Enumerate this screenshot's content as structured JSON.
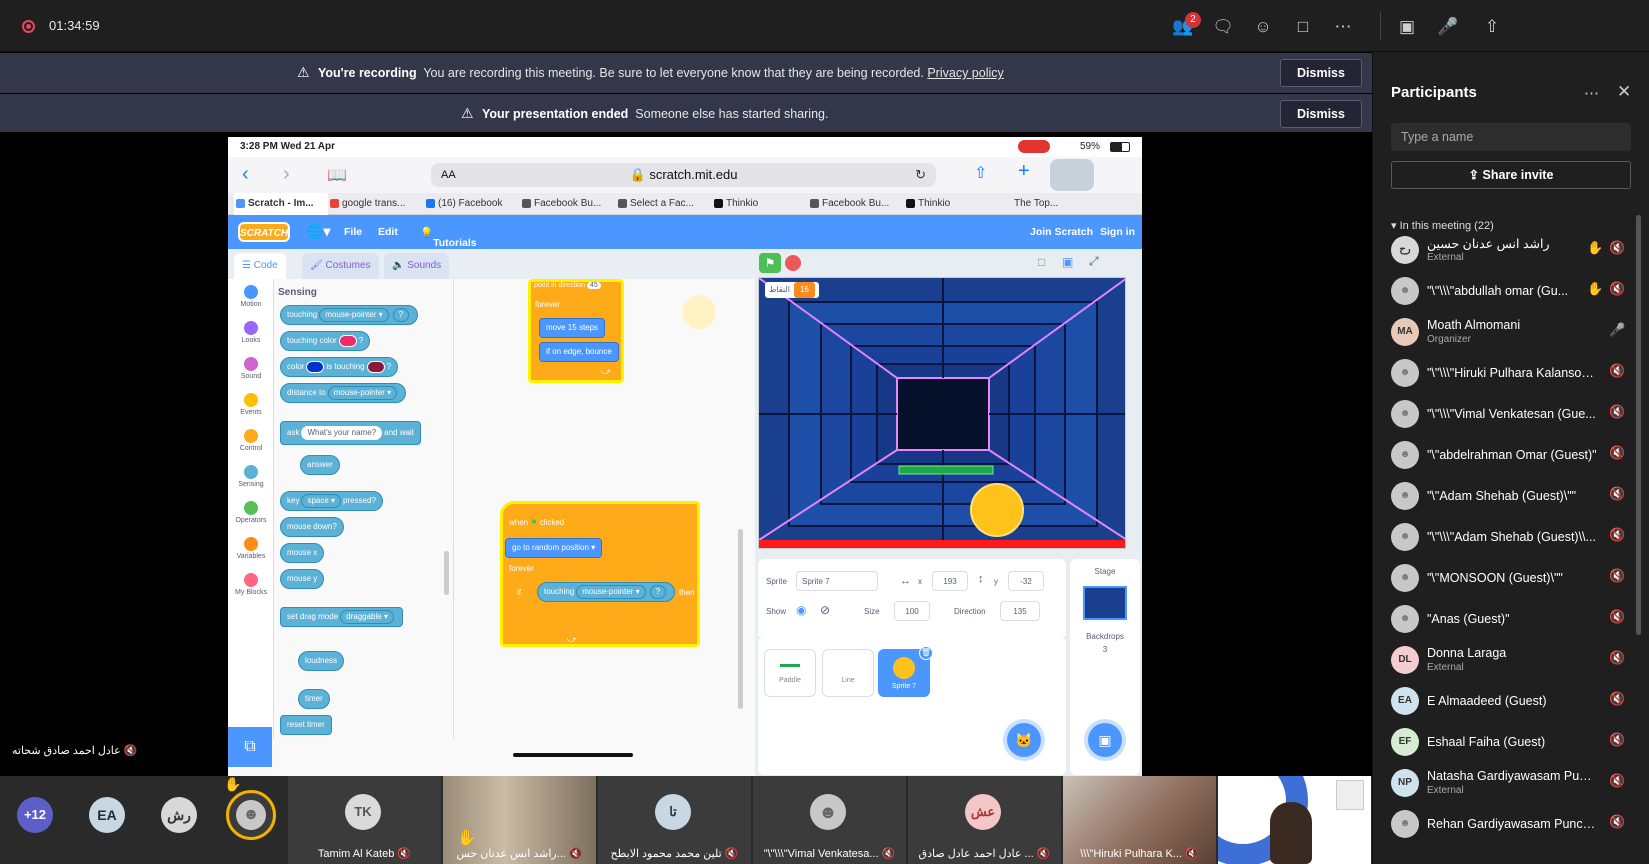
{
  "meeting": {
    "timer": "01:34:59",
    "participants_badge": "2"
  },
  "banners": [
    {
      "title": "You're recording",
      "message": "You are recording this meeting. Be sure to let everyone know that they are being recorded.",
      "link": "Privacy policy",
      "dismiss": "Dismiss"
    },
    {
      "title": "Your presentation ended",
      "message": "Someone else has started sharing.",
      "link": "",
      "dismiss": "Dismiss"
    }
  ],
  "ipad": {
    "time": "3:28 PM  Wed 21 Apr",
    "battery": "59%",
    "url": "scratch.mit.edu",
    "aa": "AA",
    "tabs": [
      "Scratch - Im...",
      "google trans...",
      "(16) Facebook",
      "Facebook Bu...",
      "Select a Fac...",
      "Thinkio",
      "Facebook Bu...",
      "Thinkio",
      "The Top..."
    ]
  },
  "scratch": {
    "menu": {
      "logo": "SCRATCH",
      "file": "File",
      "edit": "Edit",
      "tutorials": "Tutorials",
      "join": "Join Scratch",
      "signin": "Sign in"
    },
    "tabs": {
      "code": "Code",
      "costumes": "Costumes",
      "sounds": "Sounds"
    },
    "categories": [
      "Motion",
      "Looks",
      "Sound",
      "Events",
      "Control",
      "Sensing",
      "Operators",
      "Variables",
      "My Blocks"
    ],
    "category_colors": [
      "#4c97ff",
      "#9966ff",
      "#cf63cf",
      "#ffbf00",
      "#ffab19",
      "#5cb1d6",
      "#59c059",
      "#ff8c1a",
      "#ff6680"
    ],
    "palette_title": "Sensing",
    "blocks": {
      "touching": "touching",
      "mouse_pointer": "mouse-pointer ▾",
      "q": "?",
      "touching_color": "touching color",
      "color": "color",
      "is_touching": "is touching",
      "distance_to": "distance to",
      "ask": "ask",
      "whats_your_name": "What's your name?",
      "and_wait": "and wait",
      "answer": "answer",
      "key": "key",
      "space": "space ▾",
      "pressed": "pressed?",
      "mouse_down": "mouse down?",
      "mouse_x": "mouse x",
      "mouse_y": "mouse y",
      "set_drag_mode": "set drag mode",
      "draggable": "draggable ▾",
      "loudness": "loudness",
      "timer": "timer",
      "reset_timer": "reset timer"
    },
    "script1": {
      "point": "point in direction",
      "point_val": "45",
      "forever": "forever",
      "move": "move",
      "steps_val": "15",
      "steps": "steps",
      "bounce": "if on edge, bounce"
    },
    "script2": {
      "when": "when",
      "clicked": "clicked",
      "goto": "go to",
      "random": "random position ▾",
      "forever": "forever",
      "if": "if",
      "touching": "touching",
      "mouse_pointer": "mouse-pointer ▾",
      "q": "?",
      "then": "then"
    },
    "stage": {
      "score_label": "النقاط",
      "score_value": "16"
    },
    "sprite": {
      "label": "Sprite",
      "name": "Sprite 7",
      "x_label": "x",
      "x": "193",
      "y_label": "y",
      "y": "-32",
      "show": "Show",
      "size_label": "Size",
      "size": "100",
      "direction_label": "Direction",
      "direction": "135"
    },
    "sprites": [
      "Paddle",
      "Line",
      "Sprite 7"
    ],
    "stage_side": {
      "title": "Stage",
      "backdrops": "Backdrops",
      "count": "3"
    }
  },
  "presenter_label": "عادل احمد صادق شحاته",
  "bottom": {
    "more": "+12",
    "avatars": [
      "EA",
      "رش"
    ],
    "tiles": [
      {
        "initials": "TK",
        "name": "Tamim Al Kateb"
      },
      {
        "initials": "",
        "name": "راشد انس عدنان حس..."
      },
      {
        "initials": "تا",
        "name": "تلين محمد محمود الابطح"
      },
      {
        "initials": "",
        "name": "\"\\\"\\\\\\\"Vimal Venkatesa..."
      },
      {
        "initials": "عش",
        "name": "عادل احمد عادل صادق ..."
      },
      {
        "initials": "",
        "name": "\\\\\\\"Hiruki Pulhara K..."
      },
      {
        "initials": "",
        "name": ""
      }
    ]
  },
  "panel": {
    "title": "Participants",
    "search_placeholder": "Type a name",
    "share": "Share invite",
    "section": "In this meeting (22)",
    "people": [
      {
        "name": "راشد انس عدنان حسين",
        "sub": "External",
        "initials": "رح",
        "hand": true,
        "color": "#d8d8d8"
      },
      {
        "name": "\"\\\"\\\\\\\"abdullah omar (Gu...",
        "sub": "",
        "initials": "",
        "hand": true,
        "color": "#c8c8c8"
      },
      {
        "name": "Moath Almomani",
        "sub": "Organizer",
        "initials": "MA",
        "hand": false,
        "color": "#e8c8b8"
      },
      {
        "name": "\"\\\"\\\\\\\"Hiruki Pulhara Kalansoo...",
        "sub": "",
        "initials": "",
        "hand": false,
        "color": "#c8c8c8"
      },
      {
        "name": "\"\\\"\\\\\\\"Vimal Venkatesan (Gue...",
        "sub": "",
        "initials": "",
        "hand": false,
        "color": "#c8c8c8"
      },
      {
        "name": "\"\\\"abdelrahman Omar (Guest)\"",
        "sub": "",
        "initials": "",
        "hand": false,
        "color": "#c8c8c8"
      },
      {
        "name": "\"\\\"Adam Shehab (Guest)\\\"\"",
        "sub": "",
        "initials": "",
        "hand": false,
        "color": "#c8c8c8"
      },
      {
        "name": "\"\\\"\\\\\\\"Adam Shehab (Guest)\\\\...",
        "sub": "",
        "initials": "",
        "hand": false,
        "color": "#c8c8c8"
      },
      {
        "name": "\"\\\"MONSOON (Guest)\\\"\"",
        "sub": "",
        "initials": "",
        "hand": false,
        "color": "#c8c8c8"
      },
      {
        "name": "\"Anas (Guest)\"",
        "sub": "",
        "initials": "",
        "hand": false,
        "color": "#c8c8c8"
      },
      {
        "name": "Donna Laraga",
        "sub": "External",
        "initials": "DL",
        "hand": false,
        "color": "#f4cdd0"
      },
      {
        "name": "E Almaadeed (Guest)",
        "sub": "",
        "initials": "EA",
        "hand": false,
        "color": "#cfe3ef"
      },
      {
        "name": "Eshaal Faiha (Guest)",
        "sub": "",
        "initials": "EF",
        "hand": false,
        "color": "#d6ecd2"
      },
      {
        "name": "Natasha Gardiyawasam Punc...",
        "sub": "External",
        "initials": "NP",
        "hand": false,
        "color": "#cfe3ef"
      },
      {
        "name": "Rehan Gardiyawasam Punchi...",
        "sub": "",
        "initials": "",
        "hand": false,
        "color": "#c8c8c8"
      }
    ]
  }
}
